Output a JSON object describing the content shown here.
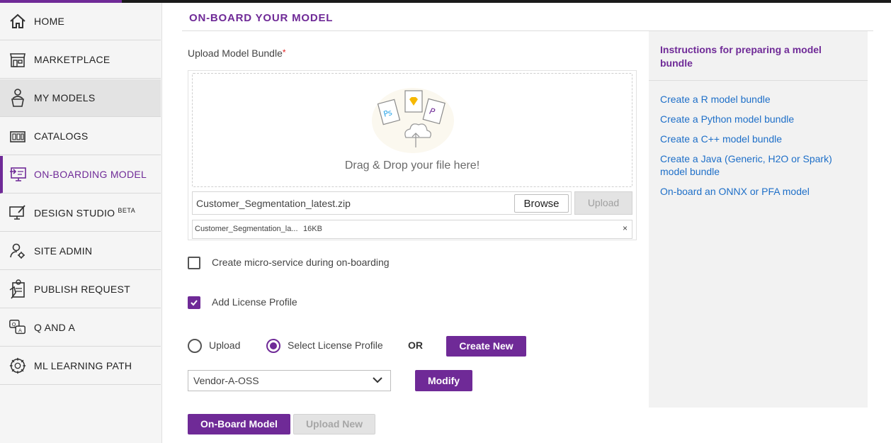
{
  "sidebar": {
    "items": [
      {
        "label": "HOME",
        "icon": "home-icon"
      },
      {
        "label": "MARKETPLACE",
        "icon": "storefront-icon"
      },
      {
        "label": "MY MODELS",
        "icon": "user-laptop-icon"
      },
      {
        "label": "CATALOGS",
        "icon": "catalog-icon"
      },
      {
        "label": "ON-BOARDING MODEL",
        "icon": "onboarding-monitor-icon"
      },
      {
        "label": "DESIGN STUDIO",
        "badge": "BETA",
        "icon": "design-monitor-icon"
      },
      {
        "label": "SITE ADMIN",
        "icon": "admin-gear-icon"
      },
      {
        "label": "PUBLISH REQUEST",
        "icon": "publish-request-icon"
      },
      {
        "label": "Q AND A",
        "icon": "qa-chat-icon"
      },
      {
        "label": "ML LEARNING PATH",
        "icon": "brain-gear-icon"
      }
    ]
  },
  "main": {
    "title": "ON-BOARD YOUR MODEL",
    "upload": {
      "label": "Upload Model Bundle",
      "required_mark": "*",
      "dropzone_text": "Drag & Drop your file here!",
      "file_value": "Customer_Segmentation_latest.zip",
      "browse_label": "Browse",
      "upload_label": "Upload",
      "file_chip_name": "Customer_Segmentation_la...",
      "file_chip_size": "16KB",
      "file_chip_close": "×"
    },
    "microservice": {
      "label": "Create micro-service during on-boarding",
      "checked": false
    },
    "license": {
      "label": "Add License Profile",
      "checked": true,
      "radio_upload": "Upload",
      "radio_select": "Select License Profile",
      "selected": "Select License Profile",
      "or_label": "OR",
      "create_new": "Create New",
      "profile_value": "Vendor-A-OSS",
      "modify": "Modify"
    },
    "actions": {
      "onboard": "On-Board Model",
      "upload_new": "Upload New"
    }
  },
  "instructions": {
    "title": "Instructions for preparing a model bundle",
    "links": [
      "Create a R model bundle",
      "Create a Python model bundle",
      "Create a C++ model bundle",
      "Create a Java (Generic, H2O or Spark) model bundle",
      "On-board an ONNX or PFA model"
    ]
  },
  "colors": {
    "accent": "#6f2a97",
    "link": "#1e6fc8",
    "disabled": "#e3e3e3",
    "required": "#e02020"
  }
}
